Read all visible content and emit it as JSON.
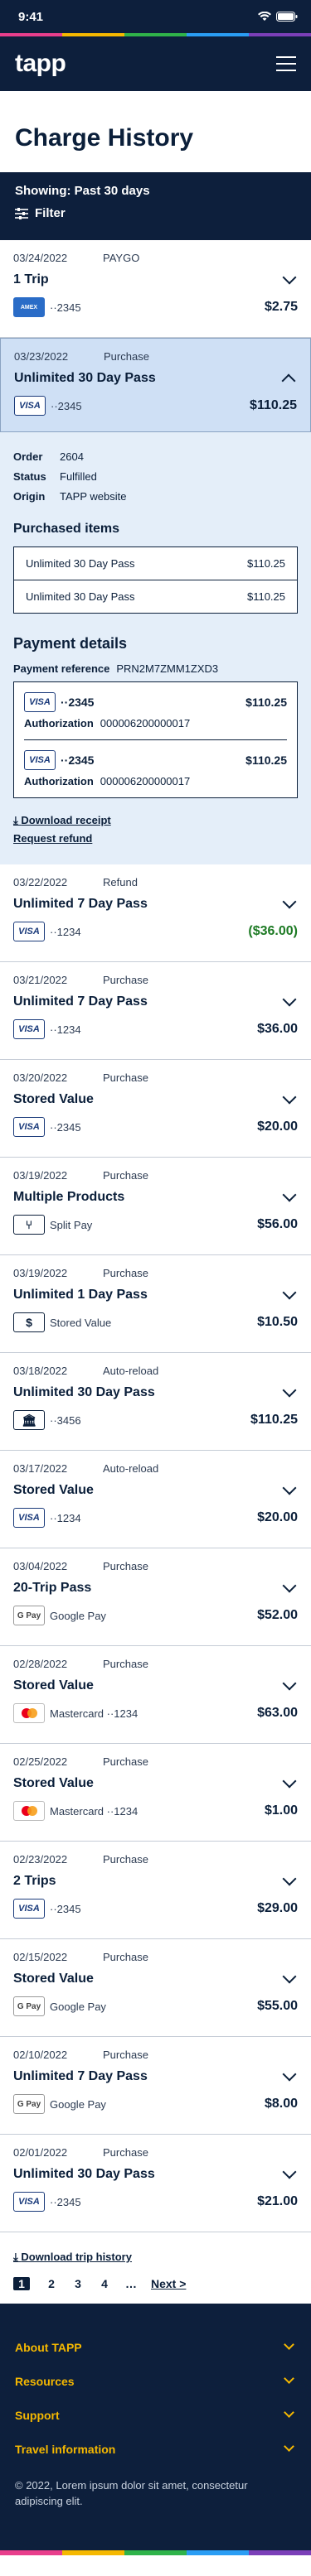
{
  "status": {
    "time": "9:41"
  },
  "brand": {
    "logo": "tapp",
    "rainbow": [
      "#e83e8c",
      "#f5b800",
      "#2fb34a",
      "#2a9df4",
      "#7b3fb8"
    ]
  },
  "page": {
    "title": "Charge History"
  },
  "filter": {
    "showing": "Showing: Past 30 days",
    "button_label": "Filter"
  },
  "entries_before": [
    {
      "date": "03/24/2022",
      "type": "PAYGO",
      "title": "1 Trip",
      "card": "amex",
      "card_text": "AMEX",
      "pay": "··2345",
      "amount": "$2.75"
    }
  ],
  "expanded": {
    "date": "03/23/2022",
    "type": "Purchase",
    "title": "Unlimited 30 Day Pass",
    "card": "visa",
    "card_text": "VISA",
    "pay": "··2345",
    "amount": "$110.25",
    "order_label": "Order",
    "order": "2604",
    "status_label": "Status",
    "status": "Fulfilled",
    "origin_label": "Origin",
    "origin": "TAPP website",
    "items_heading": "Purchased items",
    "items": [
      {
        "name": "Unlimited 30 Day Pass",
        "price": "$110.25"
      },
      {
        "name": "Unlimited 30 Day Pass",
        "price": "$110.25"
      }
    ],
    "payment_heading": "Payment details",
    "payref_label": "Payment reference",
    "payref": "PRN2M7ZMM1ZXD3",
    "payments": [
      {
        "card_text": "VISA",
        "last4": "··2345",
        "amount": "$110.25",
        "auth_label": "Authorization",
        "auth": "000006200000017"
      },
      {
        "card_text": "VISA",
        "last4": "··2345",
        "amount": "$110.25",
        "auth_label": "Authorization",
        "auth": "000006200000017"
      }
    ],
    "download_receipt": "Download receipt",
    "request_refund": "Request refund"
  },
  "entries": [
    {
      "date": "03/22/2022",
      "type": "Refund",
      "title": "Unlimited 7 Day Pass",
      "card": "visa",
      "card_text": "VISA",
      "pay": "··1234",
      "amount": "($36.00)",
      "refund": true
    },
    {
      "date": "03/21/2022",
      "type": "Purchase",
      "title": "Unlimited 7 Day Pass",
      "card": "visa",
      "card_text": "VISA",
      "pay": "··1234",
      "amount": "$36.00"
    },
    {
      "date": "03/20/2022",
      "type": "Purchase",
      "title": "Stored Value",
      "card": "visa",
      "card_text": "VISA",
      "pay": "··2345",
      "amount": "$20.00"
    },
    {
      "date": "03/19/2022",
      "type": "Purchase",
      "title": "Multiple Products",
      "card": "split",
      "card_text": "⑂",
      "pay": "Split Pay",
      "amount": "$56.00"
    },
    {
      "date": "03/19/2022",
      "type": "Purchase",
      "title": "Unlimited 1 Day Pass",
      "card": "sv",
      "card_text": "$",
      "pay": "Stored Value",
      "amount": "$10.50"
    },
    {
      "date": "03/18/2022",
      "type": "Auto-reload",
      "title": "Unlimited 30 Day Pass",
      "card": "bank",
      "card_text": "🏛",
      "pay": "··3456",
      "amount": "$110.25"
    },
    {
      "date": "03/17/2022",
      "type": "Auto-reload",
      "title": "Stored Value",
      "card": "visa",
      "card_text": "VISA",
      "pay": "··1234",
      "amount": "$20.00"
    },
    {
      "date": "03/04/2022",
      "type": "Purchase",
      "title": "20-Trip Pass",
      "card": "gpay",
      "card_text": "G Pay",
      "pay": "Google Pay",
      "amount": "$52.00"
    },
    {
      "date": "02/28/2022",
      "type": "Purchase",
      "title": "Stored Value",
      "card": "mc",
      "card_text": "",
      "pay": "Mastercard ··1234",
      "amount": "$63.00"
    },
    {
      "date": "02/25/2022",
      "type": "Purchase",
      "title": "Stored Value",
      "card": "mc",
      "card_text": "",
      "pay": "Mastercard ··1234",
      "amount": "$1.00"
    },
    {
      "date": "02/23/2022",
      "type": "Purchase",
      "title": "2 Trips",
      "card": "visa",
      "card_text": "VISA",
      "pay": "··2345",
      "amount": "$29.00"
    },
    {
      "date": "02/15/2022",
      "type": "Purchase",
      "title": "Stored Value",
      "card": "gpay",
      "card_text": "G Pay",
      "pay": "Google Pay",
      "amount": "$55.00"
    },
    {
      "date": "02/10/2022",
      "type": "Purchase",
      "title": "Unlimited 7 Day Pass",
      "card": "gpay",
      "card_text": "G Pay",
      "pay": "Google Pay",
      "amount": "$8.00"
    },
    {
      "date": "02/01/2022",
      "type": "Purchase",
      "title": "Unlimited 30 Day Pass",
      "card": "visa",
      "card_text": "VISA",
      "pay": "··2345",
      "amount": "$21.00"
    }
  ],
  "download_trip_history": "Download trip history",
  "pagination": {
    "pages": [
      "1",
      "2",
      "3",
      "4"
    ],
    "ellipsis": "…",
    "next": "Next >"
  },
  "footer": {
    "sections": [
      "About TAPP",
      "Resources",
      "Support",
      "Travel information"
    ],
    "copyright": "© 2022, Lorem ipsum dolor sit amet, consectetur adipiscing elit."
  }
}
